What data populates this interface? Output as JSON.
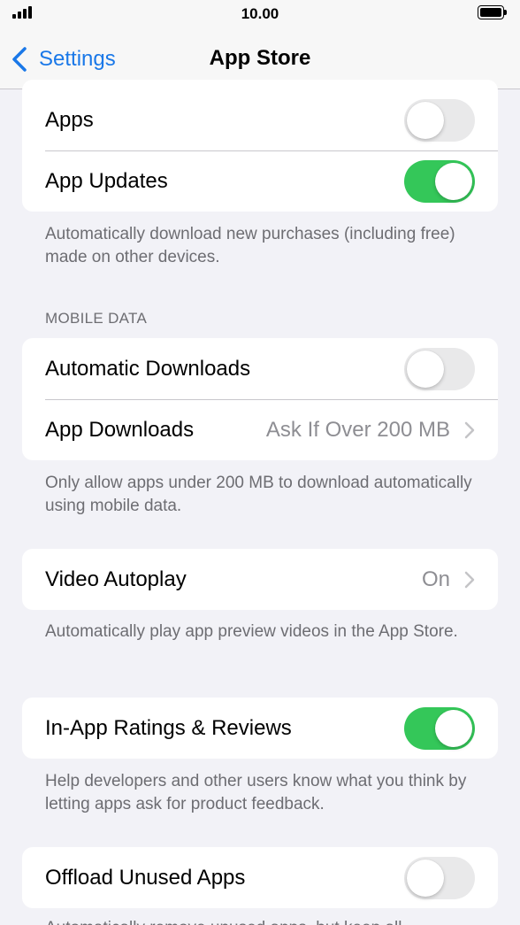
{
  "status_bar": {
    "time": "10.00"
  },
  "nav": {
    "back_label": "Settings",
    "title": "App Store"
  },
  "automatic_downloads_group": {
    "apps_label": "Apps",
    "apps_on": false,
    "app_updates_label": "App Updates",
    "app_updates_on": true,
    "footer": "Automatically download new purchases (including free) made on other devices."
  },
  "mobile_data": {
    "header": "MOBILE DATA",
    "automatic_downloads_label": "Automatic Downloads",
    "automatic_downloads_on": false,
    "app_downloads_label": "App Downloads",
    "app_downloads_value": "Ask If Over 200 MB",
    "footer": "Only allow apps under 200 MB to download automatically using mobile data."
  },
  "video_autoplay": {
    "label": "Video Autoplay",
    "value": "On",
    "footer": "Automatically play app preview videos in the App Store."
  },
  "ratings": {
    "label": "In-App Ratings & Reviews",
    "on": true,
    "footer": "Help developers and other users know what you think by letting apps ask for product feedback."
  },
  "offload": {
    "label": "Offload Unused Apps",
    "on": false,
    "footer": "Automatically remove unused apps, but keep all"
  },
  "colors": {
    "accent": "#1a78e8",
    "toggle_on": "#34c759",
    "toggle_off": "#e9e9ea"
  }
}
